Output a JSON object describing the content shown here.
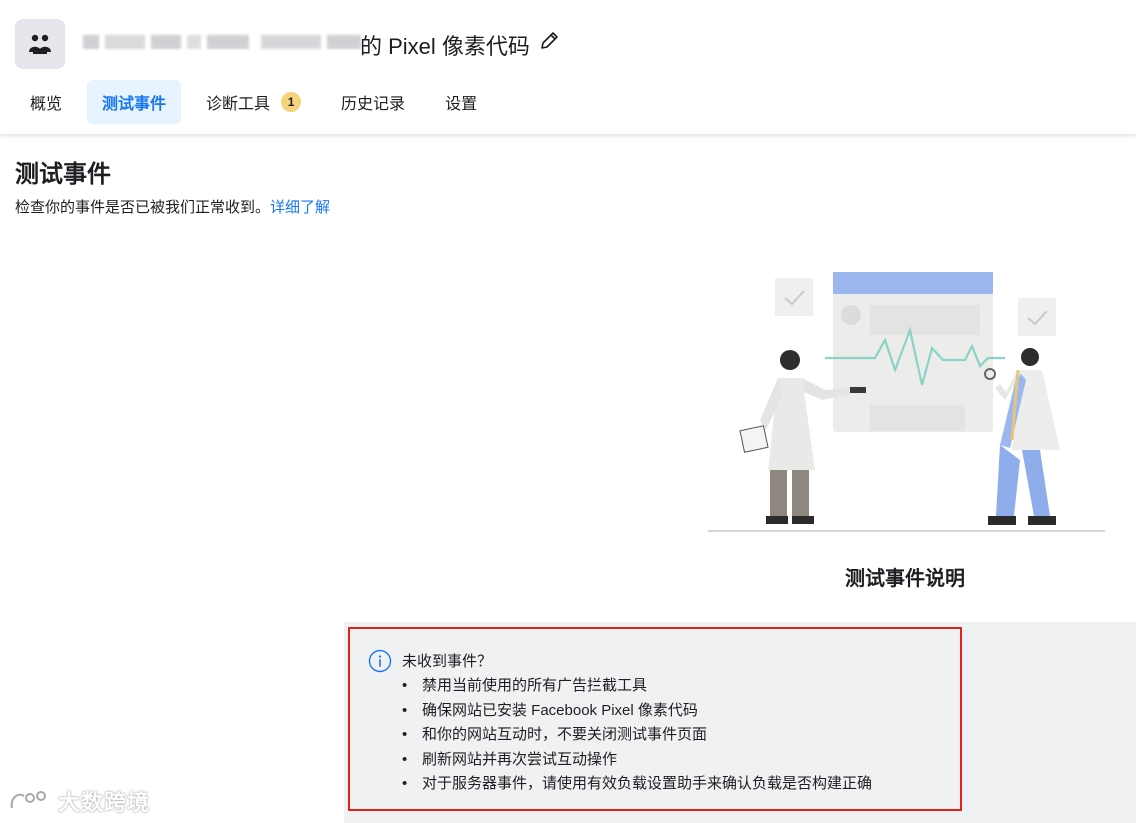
{
  "header": {
    "title_suffix": "的 Pixel 像素代码",
    "edit_icon": "pencil-icon",
    "pixel_icon": "people-icon"
  },
  "tabs": [
    {
      "label": "概览",
      "active": false
    },
    {
      "label": "测试事件",
      "active": true
    },
    {
      "label": "诊断工具",
      "active": false,
      "badge": "1"
    },
    {
      "label": "历史记录",
      "active": false
    },
    {
      "label": "设置",
      "active": false
    }
  ],
  "main": {
    "title": "测试事件",
    "subtitle": "检查你的事件是否已被我们正常收到。",
    "learn_more": "详细了解",
    "illustration_caption": "测试事件说明"
  },
  "alert": {
    "icon": "info-icon",
    "title": "未收到事件？",
    "items": [
      "禁用当前使用的所有广告拦截工具",
      "确保网站已安装 Facebook Pixel 像素代码",
      "和你的网站互动时，不要关闭测试事件页面",
      "刷新网站并再次尝试互动操作",
      "对于服务器事件，请使用有效负载设置助手来确认负载是否构建正确"
    ]
  },
  "watermark": {
    "text": "大数跨境"
  },
  "colors": {
    "accent": "#1877f2",
    "active_tab_bg": "#e7f3ff",
    "badge": "#f7d47b",
    "alert_border": "#e0241c",
    "panel_bg": "#f0f1f2"
  }
}
